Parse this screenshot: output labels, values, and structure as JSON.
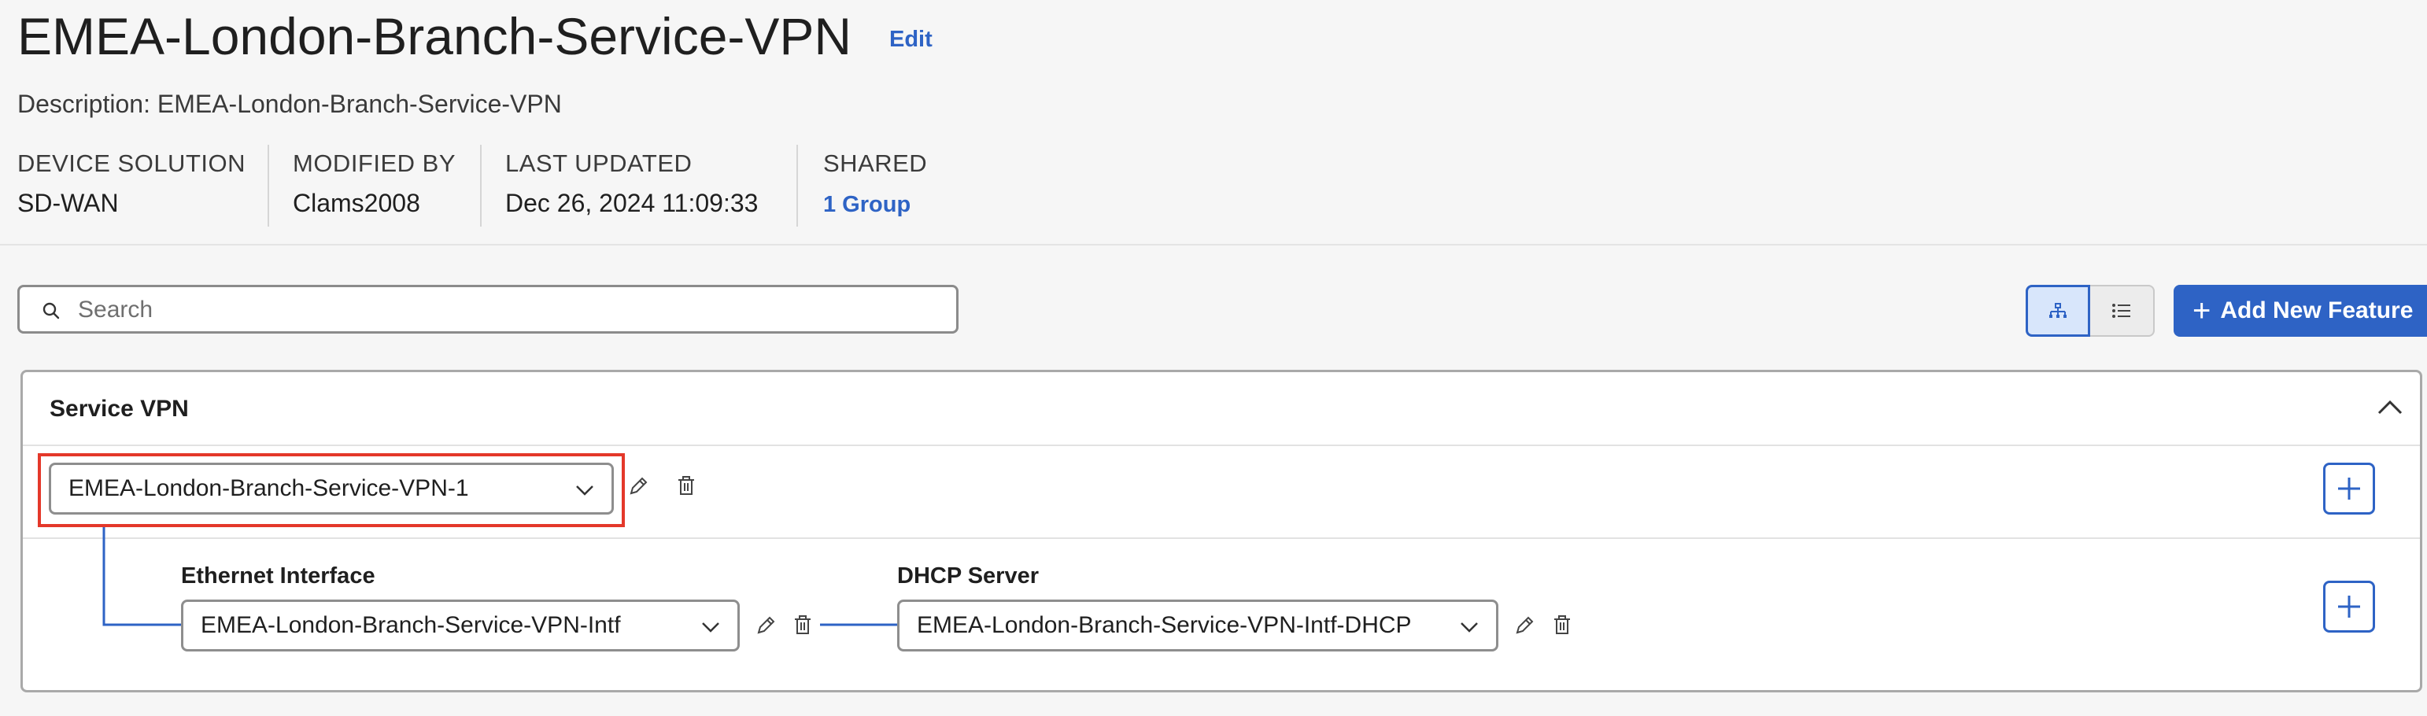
{
  "header": {
    "title": "EMEA-London-Branch-Service-VPN",
    "edit_label": "Edit",
    "description": "Description: EMEA-London-Branch-Service-VPN"
  },
  "meta": {
    "device_solution_label": "DEVICE SOLUTION",
    "device_solution_value": "SD-WAN",
    "modified_by_label": "MODIFIED BY",
    "modified_by_value": "Clams2008",
    "last_updated_label": "LAST UPDATED",
    "last_updated_value": "Dec 26, 2024 11:09:33",
    "shared_label": "SHARED",
    "shared_value": "1  Group"
  },
  "toolbar": {
    "search_placeholder": "Search",
    "add_feature_label": "Add New Feature"
  },
  "section": {
    "title": "Service VPN",
    "vpn_select_value": "EMEA-London-Branch-Service-VPN-1",
    "ethernet_label": "Ethernet Interface",
    "ethernet_select_value": "EMEA-London-Branch-Service-VPN-Intf",
    "dhcp_label": "DHCP Server",
    "dhcp_select_value": "EMEA-London-Branch-Service-VPN-Intf-DHCP"
  },
  "colors": {
    "accent": "#2e63c5",
    "highlight": "#e4382a",
    "background": "#f6f6f6"
  },
  "icons": [
    "search-icon",
    "tree-view-icon",
    "list-view-icon",
    "plus-icon",
    "chevron-up-icon",
    "chevron-down-icon",
    "pencil-icon",
    "trash-icon"
  ]
}
